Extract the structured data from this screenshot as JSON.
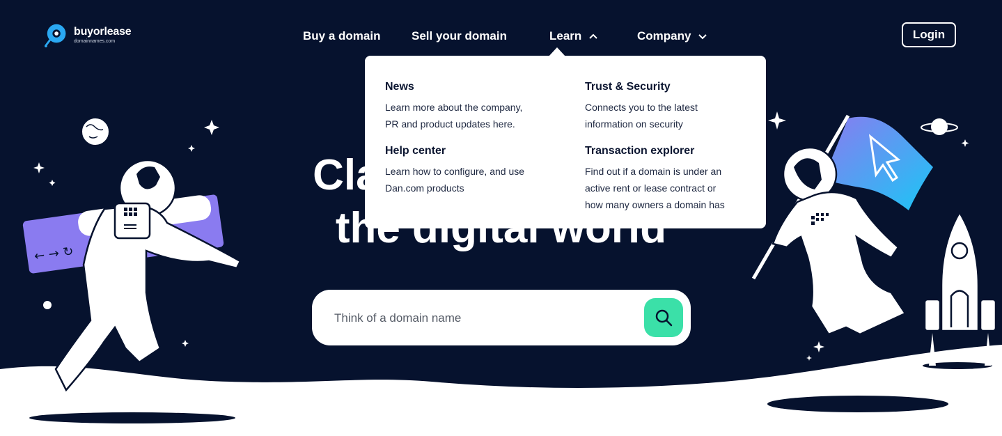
{
  "brand": {
    "name": "buyorlease",
    "sub": "domainnames.com"
  },
  "nav": [
    {
      "label": "Buy a domain"
    },
    {
      "label": "Sell your domain"
    },
    {
      "label": "Learn"
    },
    {
      "label": "Company"
    }
  ],
  "login_label": "Login",
  "hero": {
    "line1": "Claim your spot in",
    "line2": "the digital world"
  },
  "search": {
    "placeholder": "Think of a domain name"
  },
  "learn_menu": [
    {
      "title": "News",
      "description_lines": [
        "Learn more about the company,",
        "PR and product updates here."
      ]
    },
    {
      "title": "Trust & Security",
      "description_lines": [
        "Connects you to the latest",
        "information on security"
      ]
    },
    {
      "title": "Help center",
      "description_lines": [
        "Learn how to configure, and use",
        "Dan.com products"
      ]
    },
    {
      "title": "Transaction explorer",
      "description_lines": [
        "Find out if a domain is under an",
        "active rent or lease contract or",
        "how many owners a domain has"
      ]
    }
  ],
  "colors": {
    "background": "#06122e",
    "accent_green": "#3be0a8",
    "accent_purple": "#8a7bf0",
    "accent_blue": "#1bc6f5",
    "logo_blue": "#2aa8f2"
  },
  "icons": [
    "logo-icon",
    "chevron-up-icon",
    "chevron-down-icon",
    "search-icon"
  ]
}
